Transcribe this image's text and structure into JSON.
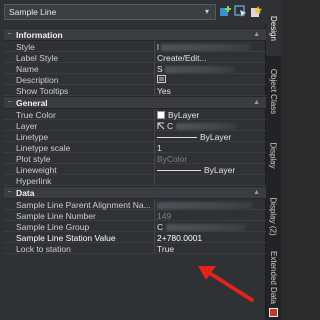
{
  "toolbar": {
    "selection": "Sample Line",
    "icons": [
      "add-to-selection-icon",
      "select-objects-icon",
      "quick-select-icon"
    ]
  },
  "sections": {
    "information": {
      "title": "Information",
      "rows": [
        {
          "label": "Style",
          "value": "l"
        },
        {
          "label": "Label Style",
          "value": "Create/Edit..."
        },
        {
          "label": "Name",
          "value": "S"
        },
        {
          "label": "Description",
          "value": ""
        },
        {
          "label": "Show Tooltips",
          "value": "Yes"
        }
      ]
    },
    "general": {
      "title": "General",
      "rows": [
        {
          "label": "True Color",
          "value": "ByLayer"
        },
        {
          "label": "Layer",
          "value": "C"
        },
        {
          "label": "Linetype",
          "value": "ByLayer"
        },
        {
          "label": "Linetype scale",
          "value": "1"
        },
        {
          "label": "Plot style",
          "value": "ByColor"
        },
        {
          "label": "Lineweight",
          "value": "ByLayer"
        },
        {
          "label": "Hyperlink",
          "value": ""
        }
      ]
    },
    "data": {
      "title": "Data",
      "rows": [
        {
          "label": "Sample Line Parent Alignment Na...",
          "value": ""
        },
        {
          "label": "Sample Line Number",
          "value": "149"
        },
        {
          "label": "Sample Line Group",
          "value": "C"
        },
        {
          "label": "Sample Line Station Value",
          "value": "2+780.0001"
        },
        {
          "label": "Lock to station",
          "value": "True"
        }
      ]
    }
  },
  "side_tabs": [
    "Design",
    "Object Class",
    "Display",
    "Display (2)",
    "Extended Data"
  ],
  "colors": {
    "annotation_arrow": "#e0241b"
  }
}
